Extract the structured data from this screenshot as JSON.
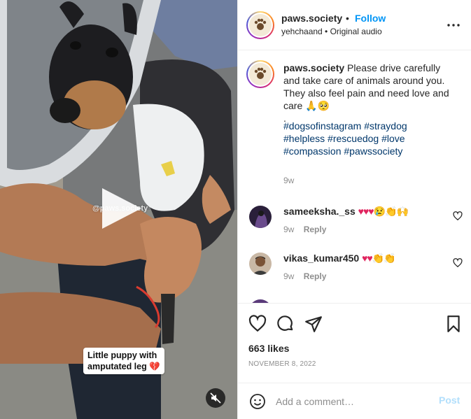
{
  "post": {
    "username": "paws.society",
    "follow_label": "Follow",
    "separator": "•",
    "subtitle": "yehchaand • Original audio",
    "more_icon": "more-horizontal-icon"
  },
  "media": {
    "watermark": "@paws.society",
    "sticker_line1": "Little puppy with",
    "sticker_line2": "amputated leg 💔",
    "play_icon": "play-icon",
    "mute_icon": "muted-speaker-icon"
  },
  "caption": {
    "username": "paws.society",
    "text": "Please drive carefully and take care of animals around you. They also feel pain and need love and care 🙏🥺",
    "dot": ".",
    "hashtags": [
      "#dogsofinstagram",
      "#straydog",
      "#helpless",
      "#rescuedog",
      "#love",
      "#compassion",
      "#pawssociety"
    ],
    "time": "9w"
  },
  "comments": [
    {
      "username": "sameeksha._ss",
      "text": "♥♥♥😢👏🙌",
      "time": "9w",
      "reply_label": "Reply"
    },
    {
      "username": "vikas_kumar450",
      "text": "♥♥👏👏",
      "time": "9w",
      "reply_label": "Reply"
    },
    {
      "username": "",
      "text": "",
      "time": "",
      "reply_label": ""
    }
  ],
  "actions": {
    "like_icon": "heart-icon",
    "comment_icon": "comment-bubble-icon",
    "share_icon": "paper-plane-icon",
    "save_icon": "bookmark-icon",
    "likes": "663 likes",
    "date": "NOVEMBER 8, 2022"
  },
  "composer": {
    "emoji_icon": "smiley-icon",
    "placeholder": "Add a comment…",
    "post_label": "Post"
  },
  "colors": {
    "link": "#0095f6",
    "hashtag": "#00376b",
    "muted": "#8e8e8e",
    "post_disabled": "#b2dffc",
    "heart": "#e0245e"
  }
}
